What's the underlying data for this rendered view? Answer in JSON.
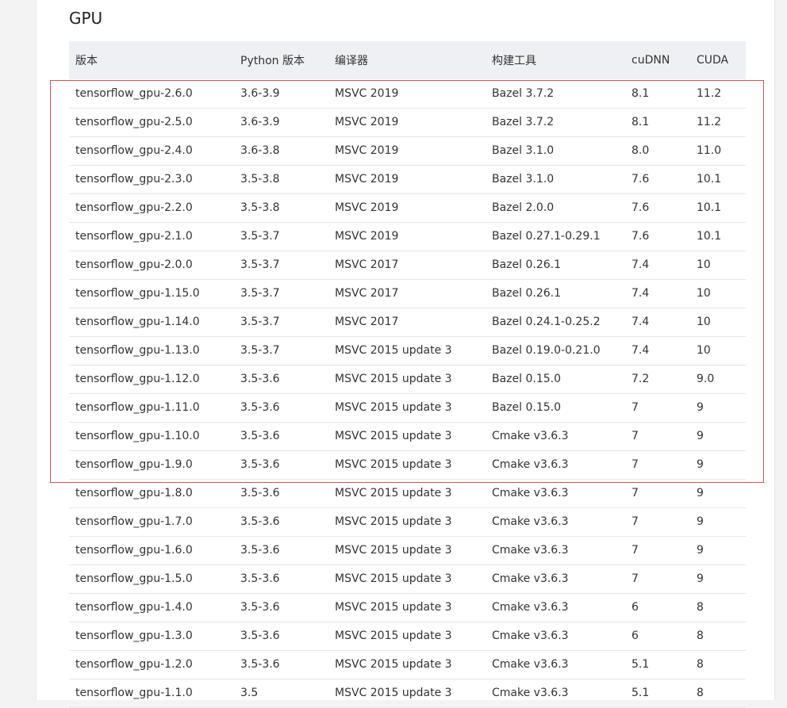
{
  "section": {
    "title": "GPU"
  },
  "table": {
    "headers": [
      "版本",
      "Python 版本",
      "编译器",
      "构建工具",
      "cuDNN",
      "CUDA"
    ],
    "rows": [
      [
        "tensorflow_gpu-2.6.0",
        "3.6-3.9",
        "MSVC 2019",
        "Bazel 3.7.2",
        "8.1",
        "11.2"
      ],
      [
        "tensorflow_gpu-2.5.0",
        "3.6-3.9",
        "MSVC 2019",
        "Bazel 3.7.2",
        "8.1",
        "11.2"
      ],
      [
        "tensorflow_gpu-2.4.0",
        "3.6-3.8",
        "MSVC 2019",
        "Bazel 3.1.0",
        "8.0",
        "11.0"
      ],
      [
        "tensorflow_gpu-2.3.0",
        "3.5-3.8",
        "MSVC 2019",
        "Bazel 3.1.0",
        "7.6",
        "10.1"
      ],
      [
        "tensorflow_gpu-2.2.0",
        "3.5-3.8",
        "MSVC 2019",
        "Bazel 2.0.0",
        "7.6",
        "10.1"
      ],
      [
        "tensorflow_gpu-2.1.0",
        "3.5-3.7",
        "MSVC 2019",
        "Bazel 0.27.1-0.29.1",
        "7.6",
        "10.1"
      ],
      [
        "tensorflow_gpu-2.0.0",
        "3.5-3.7",
        "MSVC 2017",
        "Bazel 0.26.1",
        "7.4",
        "10"
      ],
      [
        "tensorflow_gpu-1.15.0",
        "3.5-3.7",
        "MSVC 2017",
        "Bazel 0.26.1",
        "7.4",
        "10"
      ],
      [
        "tensorflow_gpu-1.14.0",
        "3.5-3.7",
        "MSVC 2017",
        "Bazel 0.24.1-0.25.2",
        "7.4",
        "10"
      ],
      [
        "tensorflow_gpu-1.13.0",
        "3.5-3.7",
        "MSVC 2015 update 3",
        "Bazel 0.19.0-0.21.0",
        "7.4",
        "10"
      ],
      [
        "tensorflow_gpu-1.12.0",
        "3.5-3.6",
        "MSVC 2015 update 3",
        "Bazel 0.15.0",
        "7.2",
        "9.0"
      ],
      [
        "tensorflow_gpu-1.11.0",
        "3.5-3.6",
        "MSVC 2015 update 3",
        "Bazel 0.15.0",
        "7",
        "9"
      ],
      [
        "tensorflow_gpu-1.10.0",
        "3.5-3.6",
        "MSVC 2015 update 3",
        "Cmake v3.6.3",
        "7",
        "9"
      ],
      [
        "tensorflow_gpu-1.9.0",
        "3.5-3.6",
        "MSVC 2015 update 3",
        "Cmake v3.6.3",
        "7",
        "9"
      ],
      [
        "tensorflow_gpu-1.8.0",
        "3.5-3.6",
        "MSVC 2015 update 3",
        "Cmake v3.6.3",
        "7",
        "9"
      ],
      [
        "tensorflow_gpu-1.7.0",
        "3.5-3.6",
        "MSVC 2015 update 3",
        "Cmake v3.6.3",
        "7",
        "9"
      ],
      [
        "tensorflow_gpu-1.6.0",
        "3.5-3.6",
        "MSVC 2015 update 3",
        "Cmake v3.6.3",
        "7",
        "9"
      ],
      [
        "tensorflow_gpu-1.5.0",
        "3.5-3.6",
        "MSVC 2015 update 3",
        "Cmake v3.6.3",
        "7",
        "9"
      ],
      [
        "tensorflow_gpu-1.4.0",
        "3.5-3.6",
        "MSVC 2015 update 3",
        "Cmake v3.6.3",
        "6",
        "8"
      ],
      [
        "tensorflow_gpu-1.3.0",
        "3.5-3.6",
        "MSVC 2015 update 3",
        "Cmake v3.6.3",
        "6",
        "8"
      ],
      [
        "tensorflow_gpu-1.2.0",
        "3.5-3.6",
        "MSVC 2015 update 3",
        "Cmake v3.6.3",
        "5.1",
        "8"
      ],
      [
        "tensorflow_gpu-1.1.0",
        "3.5",
        "MSVC 2015 update 3",
        "Cmake v3.6.3",
        "5.1",
        "8"
      ]
    ]
  },
  "colors": {
    "header_background": "#eef0f4",
    "highlight_border": "#d9534f",
    "row_divider": "#e6e6e6"
  }
}
